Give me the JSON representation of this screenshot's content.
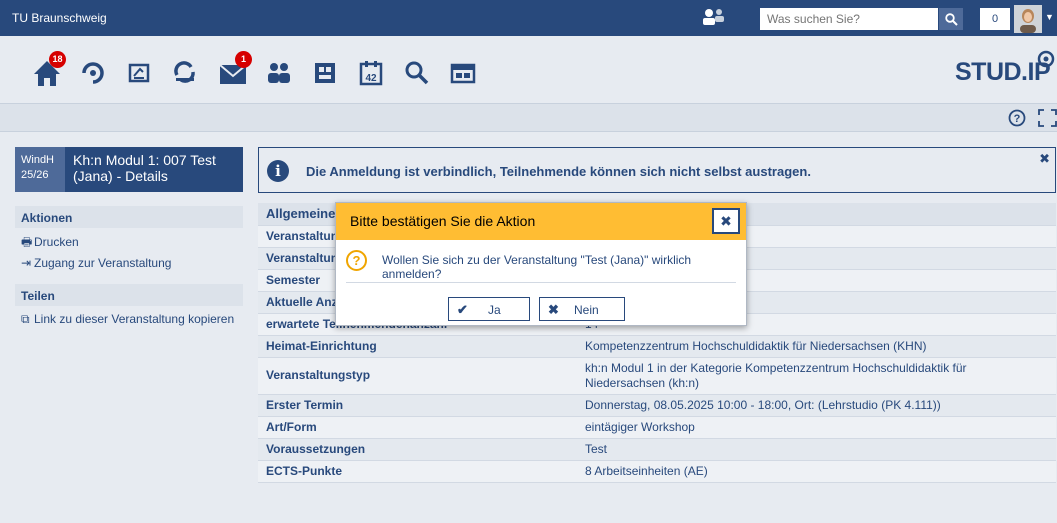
{
  "topbar": {
    "site_name": "TU Braunschweig",
    "search_placeholder": "Was suchen Sie?",
    "notification_count": "0"
  },
  "nav": {
    "home_badge": "18",
    "messages_badge": "1",
    "calendar_day": "42",
    "logo_text": "STUD.IP"
  },
  "course": {
    "semester_line1": "WindH",
    "semester_line2": "25/26",
    "title": "Kh:n Modul 1: 007 Test (Jana) - Details"
  },
  "sidebar": {
    "actions_title": "Aktionen",
    "actions": [
      {
        "label": "Drucken"
      },
      {
        "label": "Zugang zur Veranstaltung"
      }
    ],
    "share_title": "Teilen",
    "share": [
      {
        "label": "Link zu dieser Veranstaltung kopieren"
      }
    ]
  },
  "info": {
    "message": "Die Anmeldung ist verbindlich, Teilnehmende können sich nicht selbst austragen."
  },
  "details": {
    "section_title": "Allgemeine",
    "rows": [
      {
        "key": "Veranstaltung",
        "value": ""
      },
      {
        "key": "Veranstaltung",
        "value": ""
      },
      {
        "key": "Semester",
        "value": ""
      },
      {
        "key": "Aktuelle Anza",
        "value": ""
      },
      {
        "key": "erwartete Teilnehmendenanzahl",
        "value": "14"
      },
      {
        "key": "Heimat-Einrichtung",
        "value": "Kompetenzzentrum Hochschuldidaktik für Niedersachsen (KHN)"
      },
      {
        "key": "Veranstaltungstyp",
        "value": "kh:n Modul 1 in der Kategorie Kompetenzzentrum Hochschuldidaktik für Niedersachsen (kh:n)"
      },
      {
        "key": "Erster Termin",
        "value": "Donnerstag, 08.05.2025 10:00 - 18:00, Ort: (Lehrstudio (PK 4.111))"
      },
      {
        "key": "Art/Form",
        "value": "eintägiger Workshop"
      },
      {
        "key": "Voraussetzungen",
        "value": "Test"
      },
      {
        "key": "ECTS-Punkte",
        "value": "8 Arbeitseinheiten (AE)"
      }
    ]
  },
  "dialog": {
    "title": "Bitte bestätigen Sie die Aktion",
    "message": "Wollen Sie sich zu der Veranstaltung \"Test (Jana)\" wirklich anmelden?",
    "yes_label": "Ja",
    "no_label": "Nein"
  },
  "colors": {
    "brand": "#28497c",
    "dialog_header": "#ffbd33",
    "badge": "#d60000"
  }
}
